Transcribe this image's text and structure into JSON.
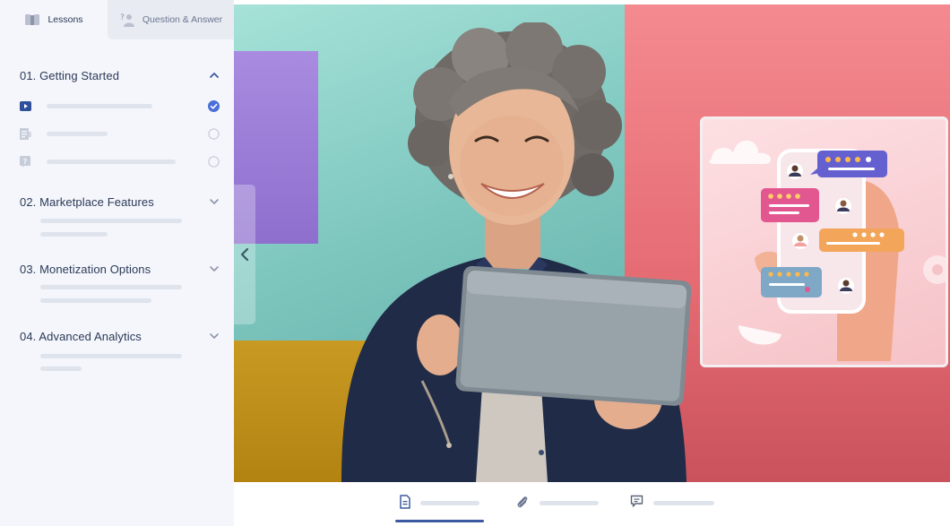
{
  "tabs": {
    "lessons": {
      "label": "Lessons",
      "icon": "book-icon"
    },
    "qa": {
      "label": "Question & Answer",
      "icon": "question-person-icon"
    }
  },
  "sections": [
    {
      "title": "01. Getting Started",
      "expanded": true
    },
    {
      "title": "02. Marketplace Features",
      "expanded": false
    },
    {
      "title": "03. Monetization Options",
      "expanded": false
    },
    {
      "title": "04. Advanced Analytics",
      "expanded": false
    }
  ],
  "lessons": [
    {
      "icon": "video-play-icon",
      "status": "completed"
    },
    {
      "icon": "document-icon",
      "status": "incomplete"
    },
    {
      "icon": "quiz-icon",
      "status": "incomplete"
    }
  ],
  "bottom_tabs": [
    {
      "icon": "document-icon",
      "active": true
    },
    {
      "icon": "paperclip-icon",
      "active": false
    },
    {
      "icon": "comment-icon",
      "active": false
    }
  ],
  "colors": {
    "accent": "#3c5aa0",
    "sidebar_bg": "#f4f6fb",
    "placeholder": "#dfe3ec",
    "check": "#4a6fd8"
  }
}
